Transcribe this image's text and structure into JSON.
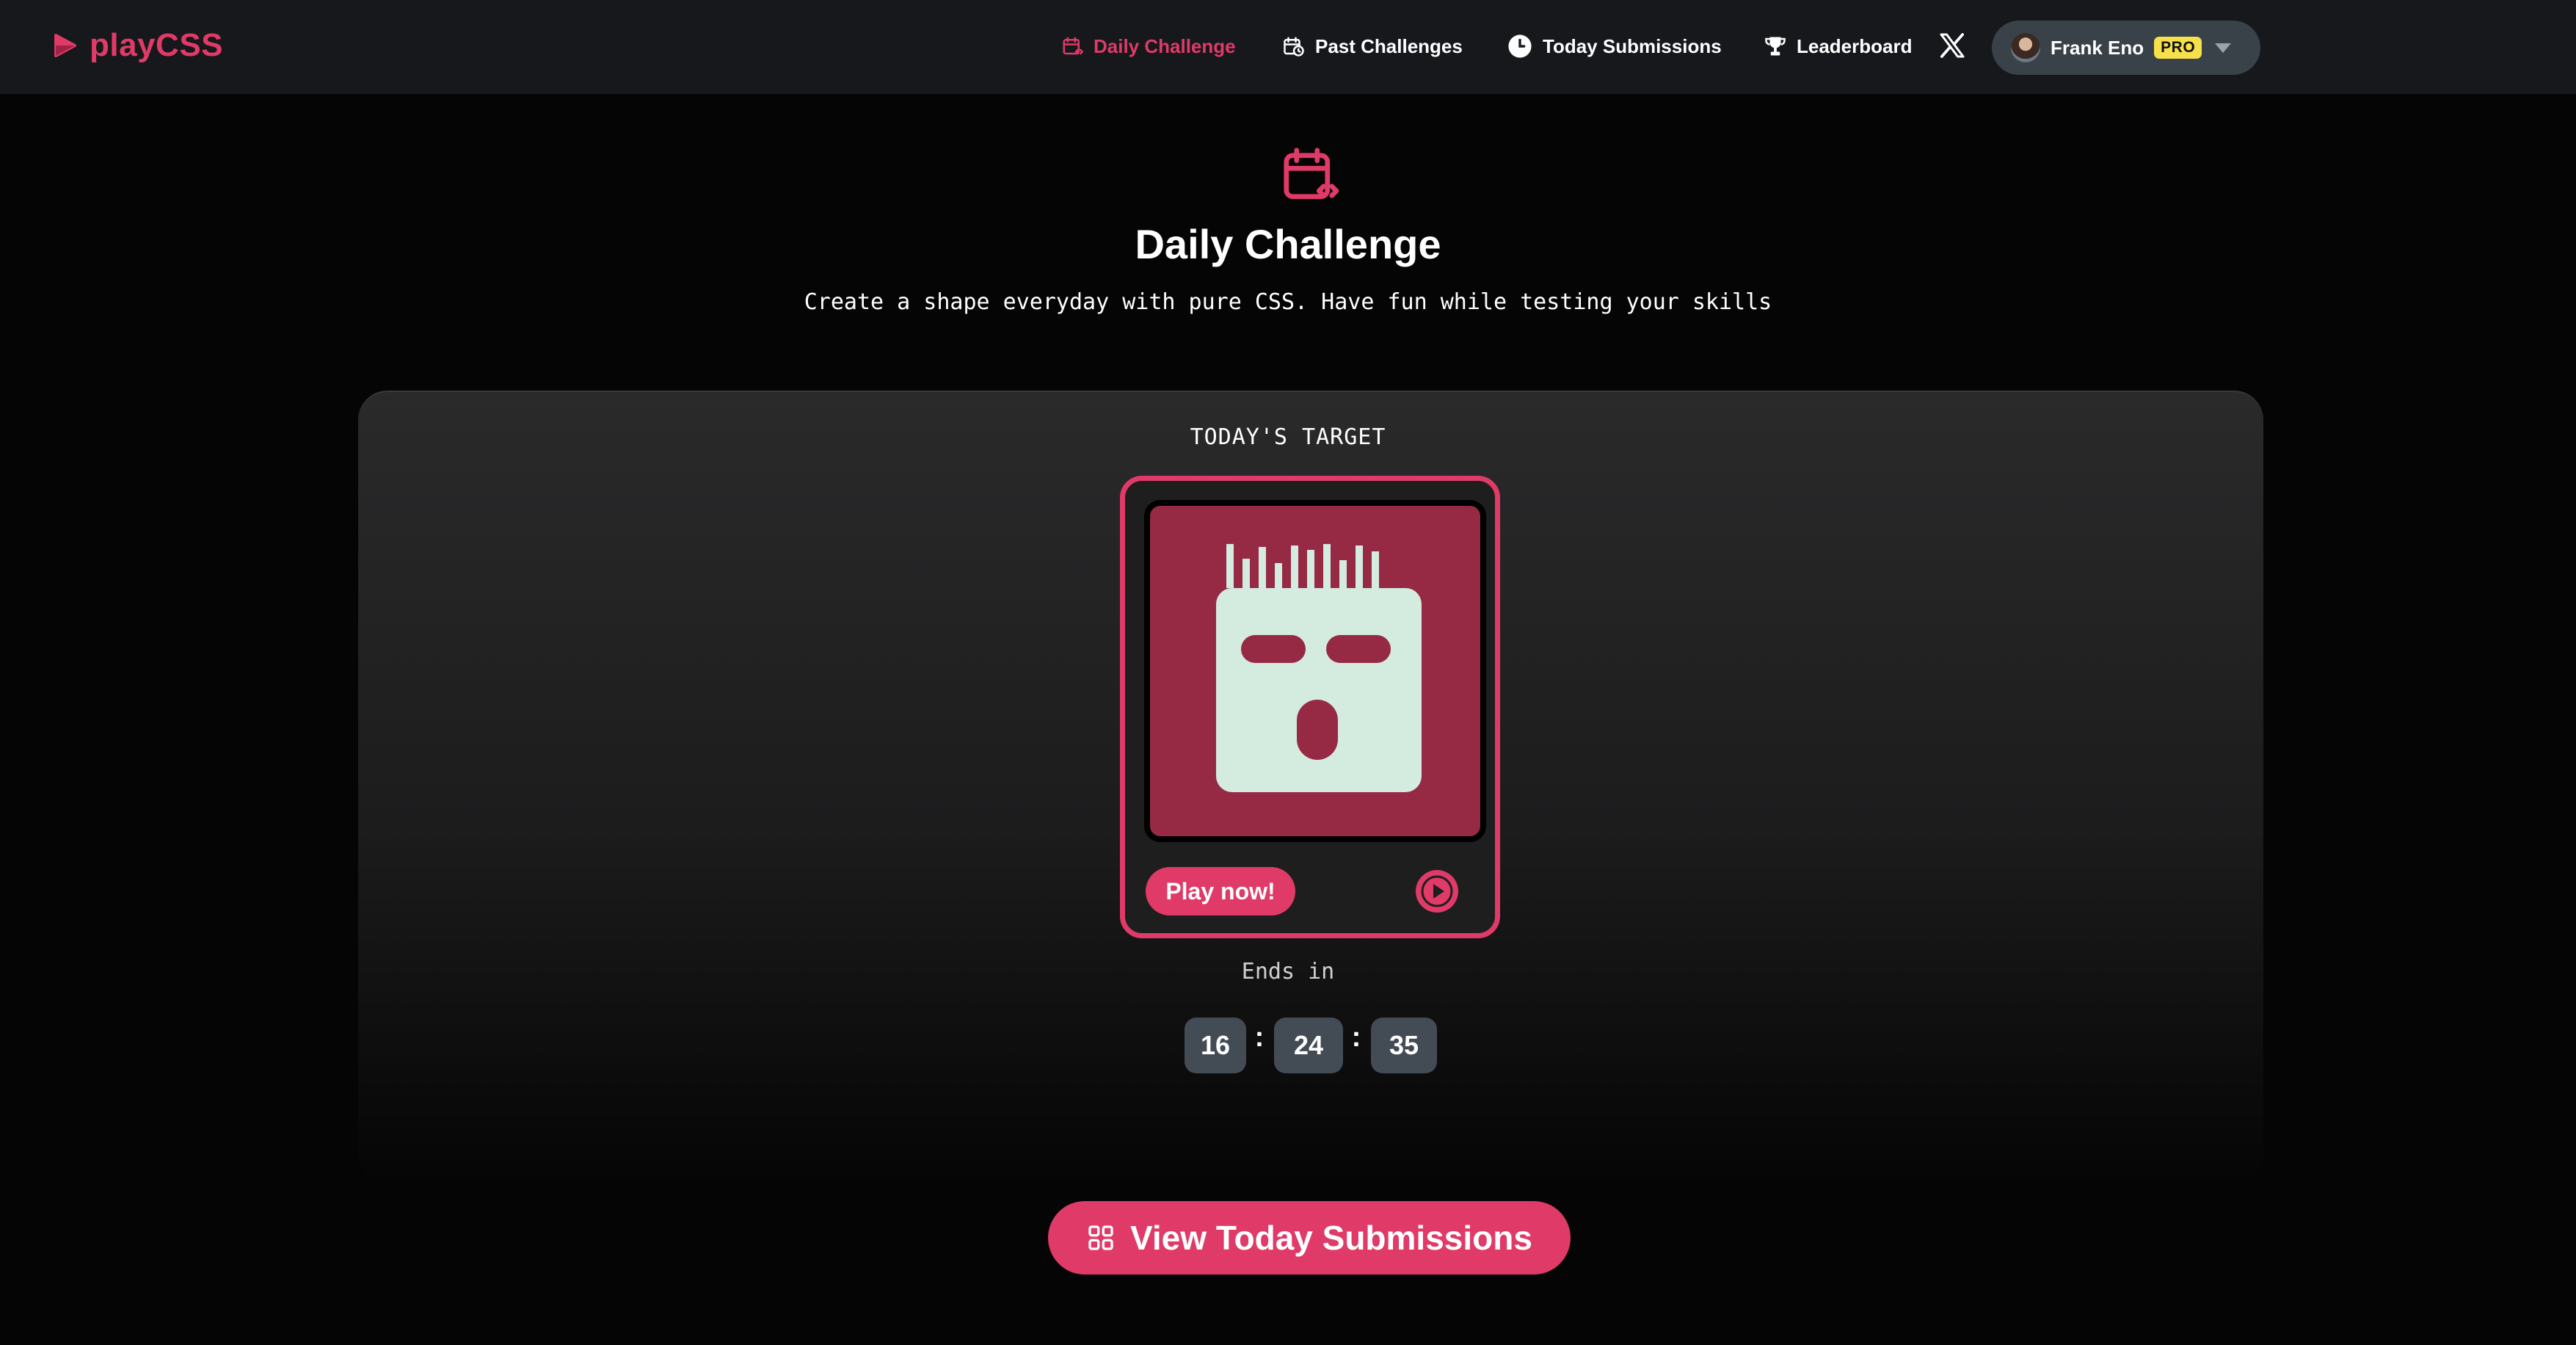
{
  "brand": {
    "name": "playCSS",
    "accent": "#e03a68"
  },
  "nav": {
    "items": [
      {
        "label": "Daily Challenge",
        "icon": "calendar-code-icon",
        "active": true
      },
      {
        "label": "Past Challenges",
        "icon": "calendar-clock-icon",
        "active": false
      },
      {
        "label": "Today Submissions",
        "icon": "clock-icon",
        "active": false
      },
      {
        "label": "Leaderboard",
        "icon": "trophy-icon",
        "active": false
      }
    ],
    "social_icon": "x-logo-icon"
  },
  "user": {
    "name": "Frank Eno",
    "badge": "PRO"
  },
  "hero": {
    "icon": "calendar-code-icon",
    "title": "Daily Challenge",
    "subtitle": "Create a shape everyday with pure CSS. Have fun while testing your skills"
  },
  "target": {
    "label": "TODAY'S TARGET",
    "play_label": "Play now!",
    "colors": {
      "background": "#962a44",
      "shape": "#d4ebe0"
    }
  },
  "countdown": {
    "label": "Ends in",
    "hours": "16",
    "minutes": "24",
    "seconds": "35",
    "separator": ":"
  },
  "cta": {
    "label": "View Today Submissions",
    "icon": "grid-icon"
  }
}
